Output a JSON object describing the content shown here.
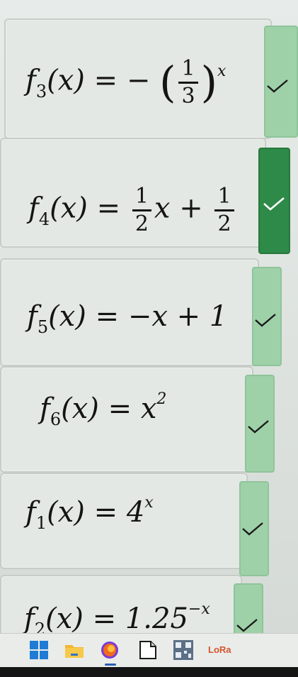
{
  "cards": [
    {
      "name": "f3",
      "fn": "f",
      "sub": "3",
      "lhs_arg": "(x)",
      "eq": "= −",
      "num": "1",
      "den": "3",
      "exp": "x",
      "status": "check-icon",
      "active": false
    },
    {
      "name": "f4",
      "fn": "f",
      "sub": "4",
      "lhs_arg": "(x)",
      "eq": "=",
      "num1": "1",
      "den1": "2",
      "mid": "x +",
      "num2": "1",
      "den2": "2",
      "status": "check-icon",
      "active": true
    },
    {
      "name": "f5",
      "fn": "f",
      "sub": "5",
      "lhs_arg": "(x)",
      "rhs": "= −x + 1",
      "status": "check-icon",
      "active": false
    },
    {
      "name": "f6",
      "fn": "f",
      "sub": "6",
      "lhs_arg": "(x)",
      "rhs": "= x",
      "exp": "2",
      "status": "check-icon",
      "active": false
    },
    {
      "name": "f1",
      "fn": "f",
      "sub": "1",
      "lhs_arg": "(x)",
      "rhs": "= 4",
      "exp": "x",
      "status": "check-icon",
      "active": false
    },
    {
      "name": "f2",
      "fn": "f",
      "sub": "2",
      "lhs_arg": "(x)",
      "rhs": "= 1.25",
      "exp": "−x",
      "status": "check-icon",
      "active": false
    }
  ],
  "colors": {
    "check_inactive": "#9fd1a8",
    "check_active": "#2e8a48"
  },
  "taskbar": {
    "icons": [
      "windows-start-icon",
      "file-explorer-icon",
      "firefox-icon",
      "notes-icon",
      "qr-app-icon"
    ],
    "app_label": "LoRa"
  }
}
